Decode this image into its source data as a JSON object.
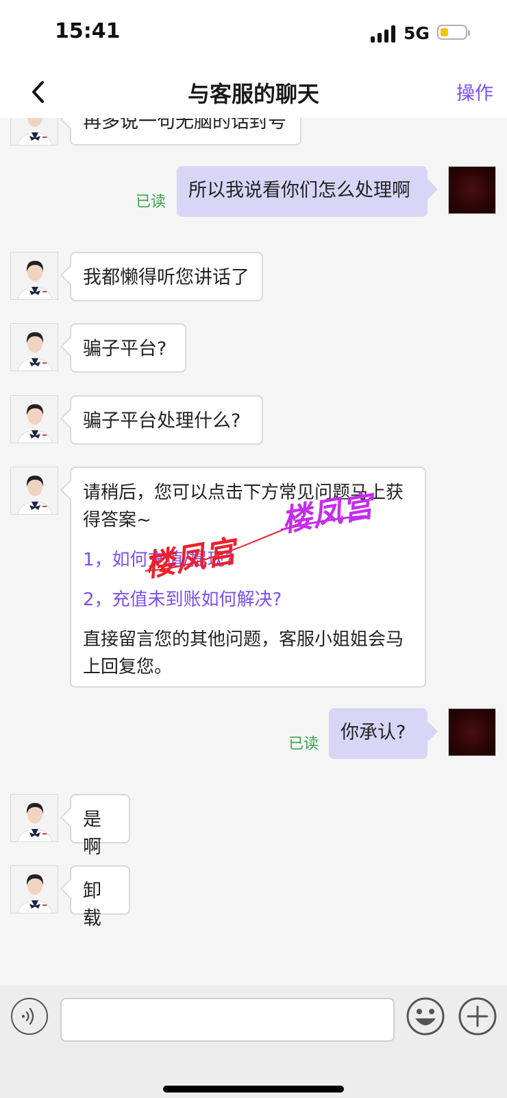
{
  "status_bar": {
    "time": "15:41",
    "network": "5G",
    "battery_level": 0.3
  },
  "nav": {
    "title": "与客服的聊天",
    "action_label": "操作",
    "accent_color": "#7b4ff5"
  },
  "messages": [
    {
      "from": "agent",
      "text": "再多说一句无脑的话封号"
    },
    {
      "from": "user",
      "text": "所以我说看你们怎么处理啊",
      "read": "已读"
    },
    {
      "from": "agent",
      "text": "我都懒得听您讲话了"
    },
    {
      "from": "agent",
      "text": "骗子平台?"
    },
    {
      "from": "agent",
      "text": "骗子平台处理什么?"
    },
    {
      "from": "agent",
      "faq": {
        "intro": "请稍后，您可以点击下方常见问题马上获得答案~",
        "links": [
          "1，如何充值/提现?",
          "2，充值未到账如何解决?"
        ],
        "outro": "直接留言您的其他问题，客服小姐姐会马上回复您。"
      }
    },
    {
      "from": "user",
      "text": "你承认?",
      "read": "已读"
    },
    {
      "from": "agent",
      "text": "是啊"
    },
    {
      "from": "agent",
      "text": "卸载"
    }
  ],
  "watermark": {
    "text_1": "楼凤宫",
    "text_2": "楼凤宫"
  },
  "input": {
    "value": "",
    "placeholder": ""
  },
  "icons": {
    "back": "chevron-left-icon",
    "voice": "voice-icon",
    "emoji": "emoji-icon",
    "add": "plus-icon"
  }
}
